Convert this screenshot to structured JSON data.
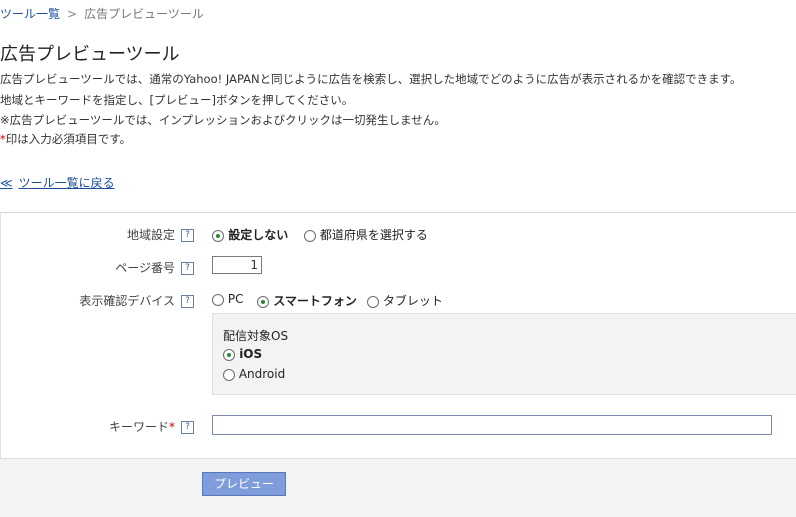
{
  "breadcrumb": {
    "parent": "ツール一覧",
    "separator": ">",
    "current": "広告プレビューツール"
  },
  "page_title": "広告プレビューツール",
  "description": {
    "line1": "広告プレビューツールでは、通常のYahoo! JAPANと同じように広告を検索し、選択した地域でどのように広告が表示されるかを確認できます。",
    "line2": "地域とキーワードを指定し、[プレビュー]ボタンを押してください。",
    "line3": "※広告プレビューツールでは、インプレッションおよびクリックは一切発生しません。",
    "required_mark": "*",
    "line4": "印は入力必須項目です。"
  },
  "back_link": {
    "chevron": "≪",
    "label": "ツール一覧に戻る"
  },
  "form": {
    "help_glyph": "?",
    "region": {
      "label": "地域設定",
      "options": [
        "設定しない",
        "都道府県を選択する"
      ],
      "selected": 0
    },
    "page_number": {
      "label": "ページ番号",
      "value": "1"
    },
    "device": {
      "label": "表示確認デバイス",
      "options": [
        "PC",
        "スマートフォン",
        "タブレット"
      ],
      "selected": 1
    },
    "os": {
      "label": "配信対象OS",
      "options": [
        "iOS",
        "Android"
      ],
      "selected": 0
    },
    "keyword": {
      "label": "キーワード",
      "required_mark": "*",
      "value": ""
    },
    "preview_button": "プレビュー"
  },
  "colors": {
    "link": "#1a4f9c",
    "required": "#cc0000",
    "button_bg": "#7f9ddb",
    "radio_dot": "#2d8a2d"
  }
}
